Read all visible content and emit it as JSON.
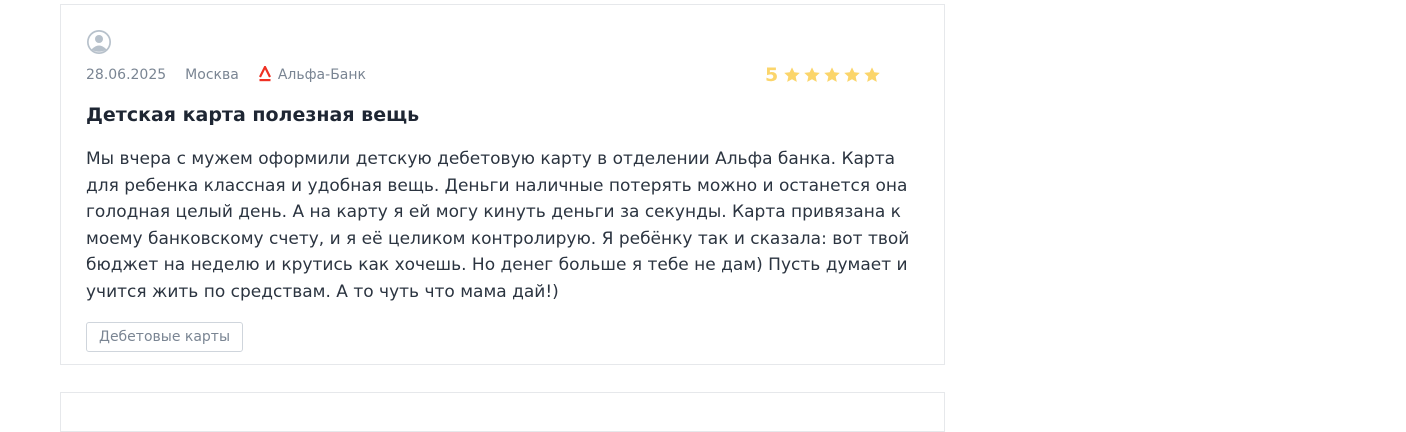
{
  "review": {
    "date": "28.06.2025",
    "city": "Москва",
    "bank": "Альфа-Банк",
    "bank_logo_color": "#ef3124",
    "rating_value": "5",
    "stars_filled": 5,
    "stars_total": 5,
    "star_color": "#fbd56b",
    "title": "Детская карта полезная вещь",
    "text": "Мы вчера с мужем оформили детскую дебетовую карту в отделении Альфа банка. Карта для ребенка классная и удобная вещь. Деньги наличные потерять можно и останется она голодная целый день. А на карту я ей могу кинуть деньги за секунды. Карта привязана к моему банковскому счету, и я её целиком контролирую. Я ребёнку так и сказала: вот твой бюджет на неделю и крутись как хочешь. Но денег больше я тебе не дам) Пусть думает и учится жить по средствам. А то чуть что мама дай!)",
    "tag": "Дебетовые карты",
    "avatar_icon": "user-avatar-icon"
  }
}
